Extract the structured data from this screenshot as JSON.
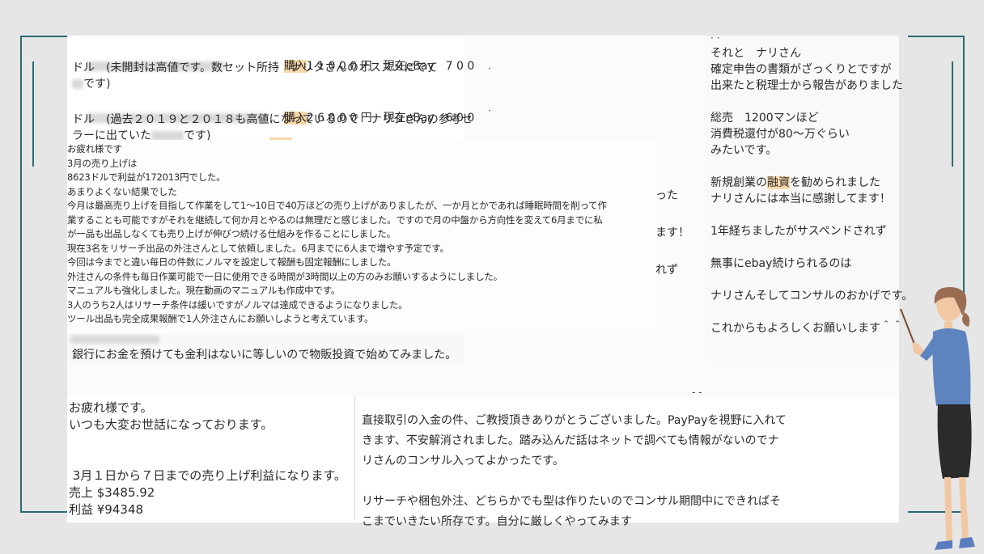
{
  "card1": {
    "line1_after": "1 1 0 0 0 円　現在eBay　7 0 0",
    "line2": "ドル　(未開封は高値です。数セット所持　ナリタさんのオススメにでて",
    "line3_after": "です)",
    "line4_after": "2 6 0 0 0 円　現在eBay　6 0 0",
    "line5": "ドル　(過去２０１９と２０１８も高値になっているので　ナリタさんの参考セ",
    "line6_before": "ラーに出ていた",
    "line6_after": "です)",
    "purchase_label": "購入"
  },
  "card2": {
    "lines": [
      "お疲れ様です",
      "3月の売り上げは",
      "8623ドルで利益が172013円でした。",
      "あまりよくない結果でした",
      "今月は最高売り上げを目指して作業をして1〜10日で40万ほどの売り上げがありましたが、一か月とかであれば睡眠時間を削って作",
      "業することも可能ですがそれを継続して何か月とやるのは無理だと感じました。ですので月の中盤から方向性を変えて6月までに私",
      "が一品も出品しなくても売り上げが伸びつ続ける仕組みを作ることにしました。",
      "現在3名をリサーチ出品の外注さんとして依頼しました。6月までに6人まで増やす予定です。",
      "今回は今までと違い毎日の件数にノルマを設定して報酬も固定報酬にしました。",
      "外注さんの条件も毎日作業可能で一日に使用できる時間が3時間以上の方のみお願いするようにしました。",
      "マニュアルも強化しました。現在動画のマニュアルも作成中です。",
      "3人のうち2人はリサーチ条件は緩いですがノルマは達成できるようになりました。",
      "ツール出品も完全成果報酬で1人外注さんにお願いしようと考えています。"
    ]
  },
  "card2b": {
    "text": "銀行にお金を預けても金利はないに等しいので物販投資で始めてみました。"
  },
  "peek": {
    "a": "った",
    "b": "ます！",
    "c": "れず"
  },
  "card3": {
    "lines": [
      "それと　ナリさん",
      "確定申告の書類がざっくりとですが",
      "出来たと税理士から報告がありました",
      "",
      "総売　1200マンほど",
      "消費税還付が80〜万ぐらい",
      "みたいです。",
      "",
      "",
      "ナリさんには本当に感謝してます！",
      "",
      "1年経ちましたがサスペンドされず",
      "",
      "無事にebay続けられるのは",
      "",
      "ナリさんそしてコンサルのおかげです。",
      "",
      "これからもよろしくお願いします＾＾"
    ],
    "line_kigyo_before": "新規創業の",
    "line_kigyo_hl": "融資",
    "line_kigyo_after": "を勧められました"
  },
  "card4": {
    "lines": [
      "お疲れ様です。",
      "いつも大変お世話になっております。",
      "",
      "",
      " 3月１日から７日までの売り上げ利益になります。",
      "売上 $3485.92",
      "利益 ¥94348"
    ]
  },
  "card5": {
    "lines": [
      "直接取引の入金の件、ご教授頂きありがとうございました。PayPayを視野に入れて",
      "きます、不安解消されました。踏み込んだ話はネットで調べても情報がないのでナ",
      "リさんのコンサル入ってよかったです。",
      "",
      "リサーチや梱包外注、どちらかでも型は作りたいのでコンサル期間中にできればそ",
      "こまでいきたい所存です。自分に厳しくやってみます"
    ]
  },
  "colors": {
    "frame": "#2b6b73",
    "highlight": "#f8d7a8",
    "background": "#e6e6e6"
  }
}
